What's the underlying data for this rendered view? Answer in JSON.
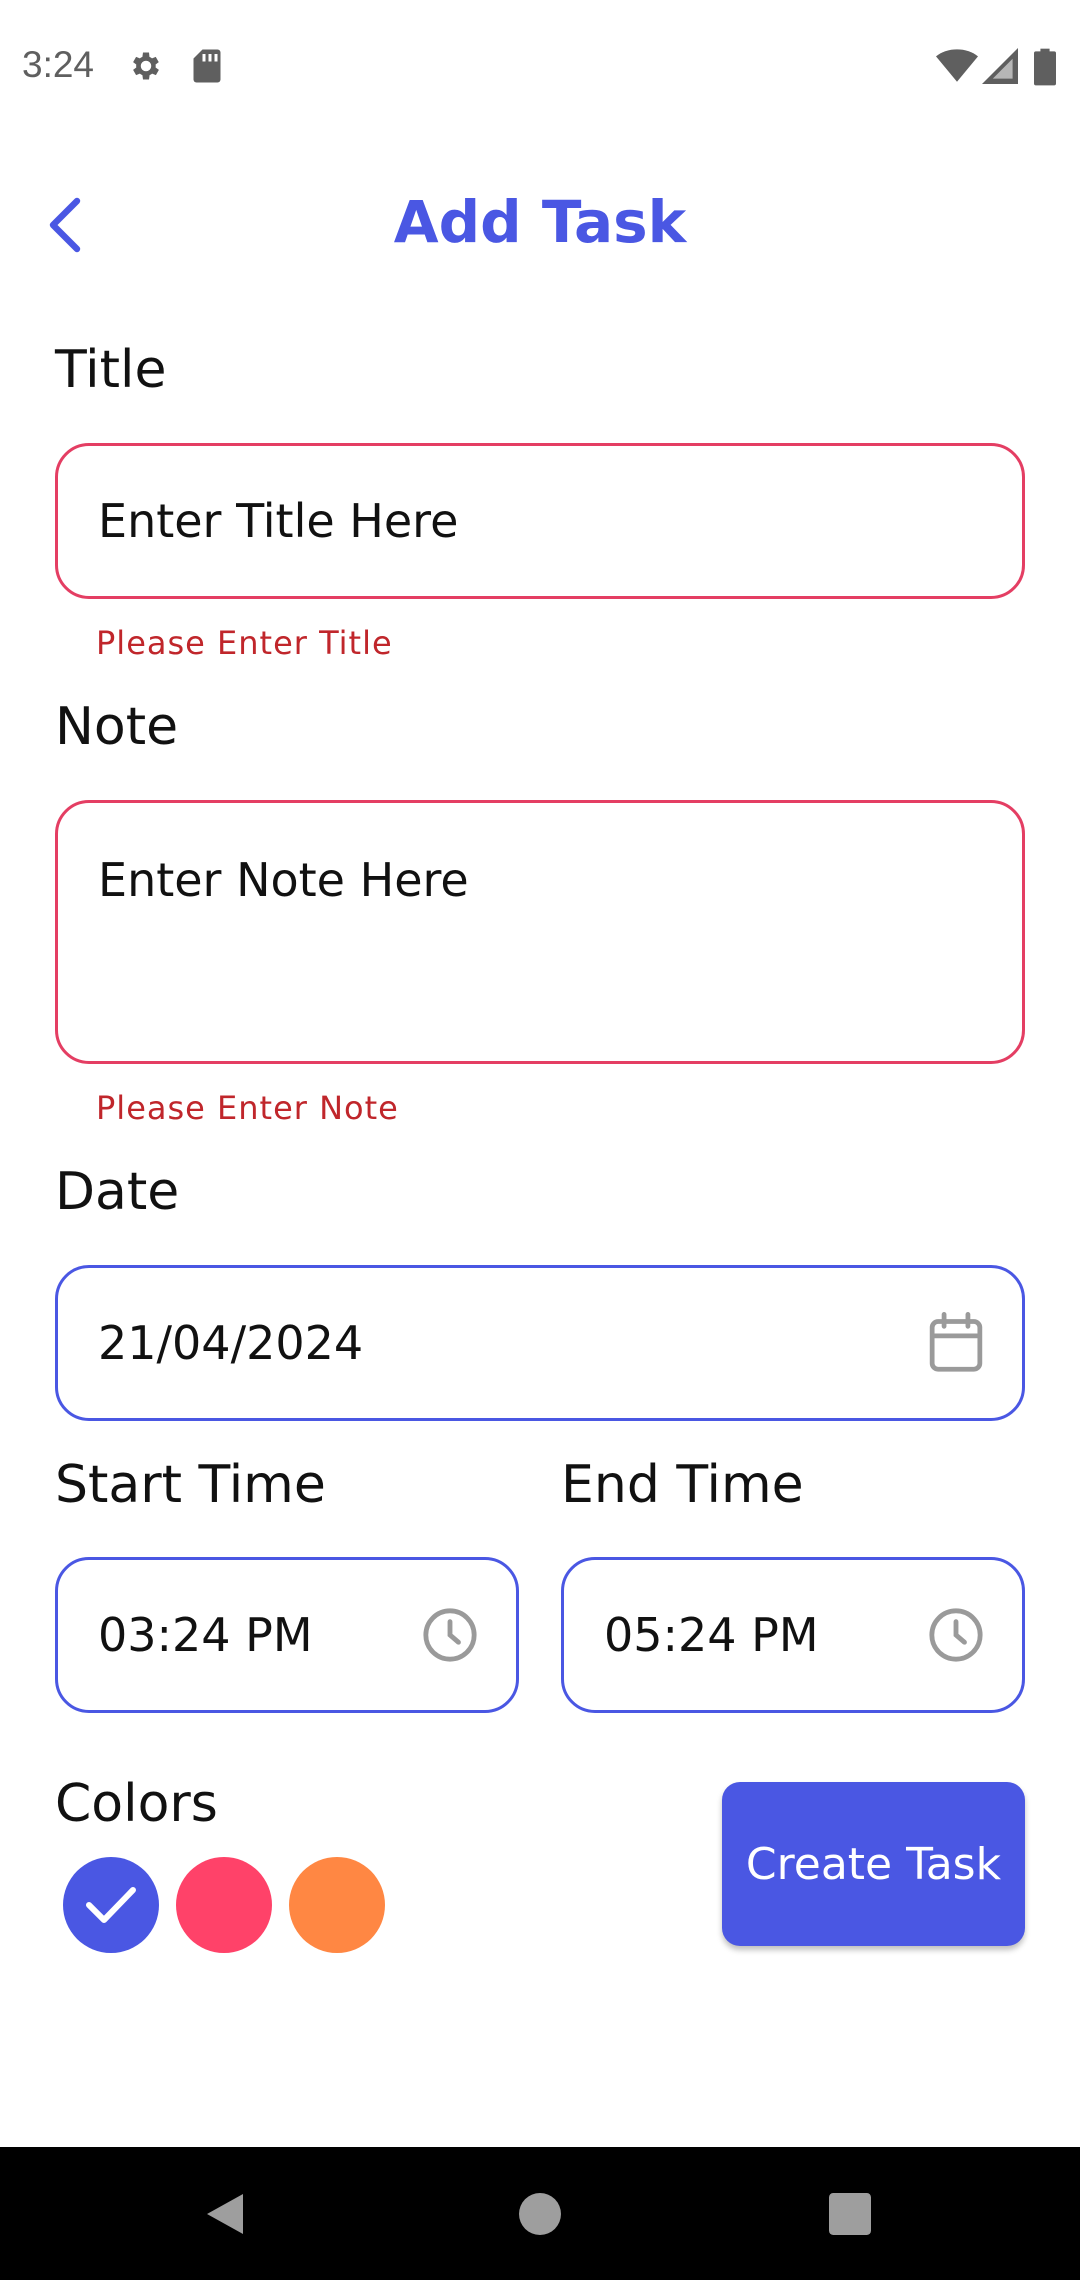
{
  "status_bar": {
    "time": "3:24",
    "left_icons": [
      "settings-icon",
      "sd-card-icon"
    ],
    "right_icons": [
      "wifi-icon",
      "signal-icon",
      "battery-icon"
    ]
  },
  "app_bar": {
    "title": "Add Task",
    "back_icon": "chevron-left-icon"
  },
  "form": {
    "title": {
      "label": "Title",
      "placeholder": "Enter Title Here",
      "error": "Please Enter Title"
    },
    "note": {
      "label": "Note",
      "placeholder": "Enter Note Here",
      "error": "Please Enter Note"
    },
    "date": {
      "label": "Date",
      "value": "21/04/2024",
      "icon": "calendar-icon"
    },
    "start_time": {
      "label": "Start Time",
      "value": "03:24 PM",
      "icon": "clock-icon"
    },
    "end_time": {
      "label": "End Time",
      "value": "05:24 PM",
      "icon": "clock-icon"
    }
  },
  "colors": {
    "label": "Colors",
    "options": [
      {
        "name": "blue",
        "hex": "#4a57e3",
        "selected": true
      },
      {
        "name": "pink",
        "hex": "#ff4269",
        "selected": false
      },
      {
        "name": "orange",
        "hex": "#ff8743",
        "selected": false
      }
    ]
  },
  "create_button": {
    "label": "Create Task"
  },
  "theme": {
    "accent": "#4a57e3",
    "error_border": "#e43e63",
    "error_text": "#c0262b"
  },
  "nav_bar": {
    "icons": [
      "back-icon",
      "home-icon",
      "recents-icon"
    ]
  }
}
